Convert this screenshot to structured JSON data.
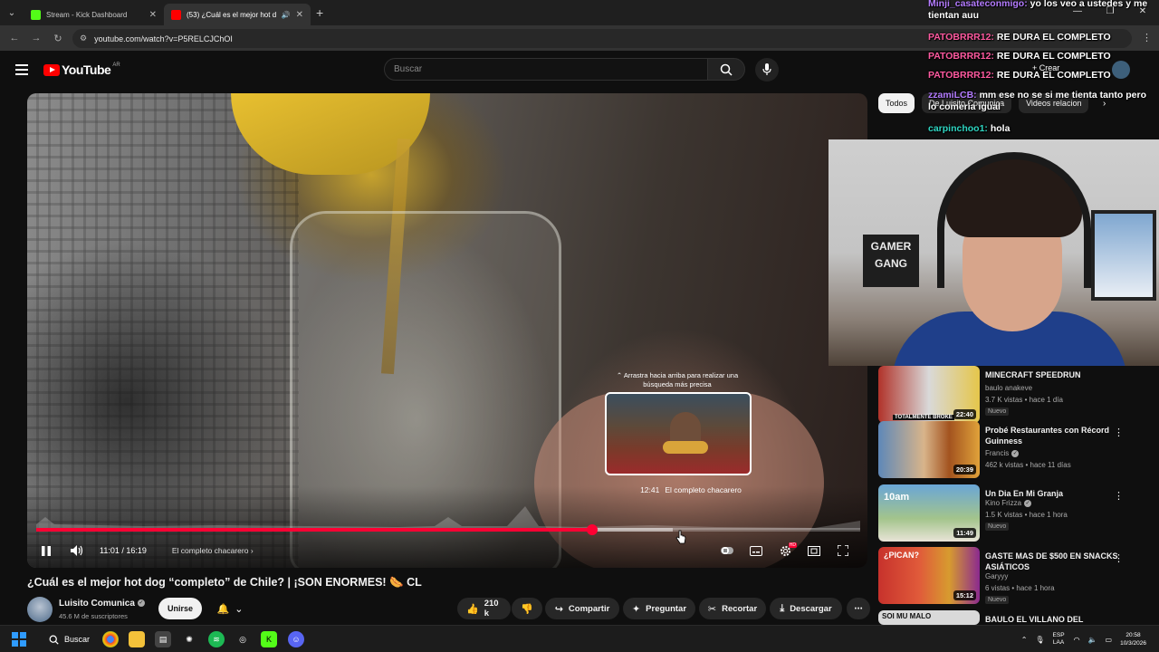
{
  "browser": {
    "tabs": [
      {
        "title": "Stream - Kick Dashboard",
        "active": false
      },
      {
        "title": "(53) ¿Cuál es el mejor hot d",
        "active": true
      }
    ],
    "url": "youtube.com/watch?v=P5RELCJChOI"
  },
  "header": {
    "logo_text": "YouTube",
    "country": "AR",
    "search_placeholder": "Buscar",
    "create_label": "Crear"
  },
  "player": {
    "drag_hint": "Arrastra hacia arriba para realizar una búsqueda más precisa",
    "preview_time": "12:41",
    "preview_chapter": "El completo chacarero",
    "time_display": "11:01 / 16:19",
    "chapter": "El completo chacarero",
    "played_fraction": 0.675,
    "hover_fraction": 0.772
  },
  "video": {
    "title": "¿Cuál es el mejor hot dog “completo” de Chile? | ¡SON ENORMES! 🌭 CL",
    "channel": "Luisito Comunica",
    "subscribers": "45.6 M de suscriptores",
    "join_label": "Unirse",
    "likes": "210 k",
    "share_label": "Compartir",
    "ask_label": "Preguntar",
    "clip_label": "Recortar",
    "download_label": "Descargar"
  },
  "sidebar": {
    "chips": [
      "Todos",
      "De Luisito Comunica",
      "Videos relacion"
    ],
    "items": [
      {
        "title": "MINECRAFT SPEEDRUN",
        "channel": "baulo anakeve",
        "meta": "3.7 K vistas • hace 1 día",
        "badge": "Nuevo",
        "duration": "22:40",
        "thumb_text": "TOTALMENTE BROKE"
      },
      {
        "title": "Probé Restaurantes con Récord Guinness",
        "channel": "Francis",
        "meta": "462 k vistas • hace 11 días",
        "badge": "",
        "duration": "20:39",
        "thumb_text": ""
      },
      {
        "title": "Un Dia En Mi Granja",
        "channel": "Kino Frizza",
        "meta": "1.5 K vistas • hace 1 hora",
        "badge": "Nuevo",
        "duration": "11:49",
        "thumb_text": "10am"
      },
      {
        "title": "GASTE MAS DE  $500 EN SNACKS ASIÁTICOS",
        "channel": "Garyyy",
        "meta": "6 vistas • hace 1 hora",
        "badge": "Nuevo",
        "duration": "15:12",
        "thumb_text": "¿PICAN?"
      },
      {
        "title": "BAULO EL VILLANO DEL",
        "channel": "",
        "meta": "",
        "badge": "",
        "duration": "",
        "thumb_text": "SOI MU MALO"
      }
    ]
  },
  "chat": [
    {
      "user": "Minji_casateconmigo:",
      "text": "yo los veo a ustedes y me tientan auu",
      "color": "purple"
    },
    {
      "user": "PATOBRRR12:",
      "text": "RE DURA EL COMPLETO",
      "color": "pink"
    },
    {
      "user": "PATOBRRR12:",
      "text": "RE DURA EL COMPLETO",
      "color": "pink"
    },
    {
      "user": "PATOBRRR12:",
      "text": "RE DURA EL COMPLETO",
      "color": "pink"
    },
    {
      "user": "zzamiLCB:",
      "text": "mm ese no se si me tienta tanto pero lo comería igual",
      "color": "purple"
    },
    {
      "user": "carpinchoo1:",
      "text": "hola",
      "color": "teal"
    }
  ],
  "webcam": {
    "poster_text": "GAMER GANG"
  },
  "taskbar": {
    "search_label": "Buscar",
    "lang_top": "ESP",
    "lang_bottom": "LAA",
    "time": "20:58",
    "date": "10/3/2026"
  }
}
